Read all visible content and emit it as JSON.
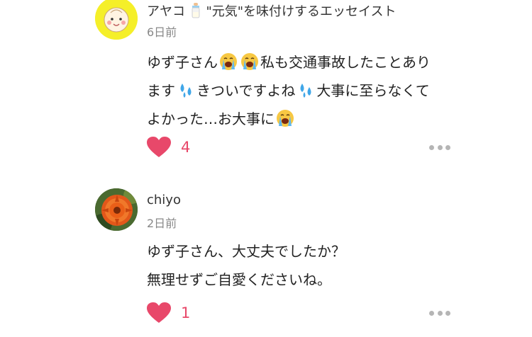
{
  "comments": [
    {
      "name_part1": "アヤコ",
      "name_part2": "\"元気\"を味付けするエッセイスト",
      "time": "6日前",
      "line1_a": "ゆず子さん",
      "line1_b": "私も交通事故したことあり",
      "line2_a": "ます",
      "line2_b": "きついですよね",
      "line2_c": "大事に至らなくて",
      "line3_a": "よかった…お大事に",
      "likes": "4",
      "avatar_icon": "smiling-baby-face-icon",
      "name_icon": "baby-bottle-icon"
    },
    {
      "name": "chiyo",
      "time": "2日前",
      "line1": "ゆず子さん、大丈夫でしたか？",
      "line2": "無理せずご自愛くださいね。",
      "likes": "1",
      "avatar_icon": "orange-flower-photo"
    }
  ],
  "icons": {
    "heart": "heart-icon",
    "more": "more-options-icon",
    "crying": "loudly-crying-face-emoji",
    "sweat": "sweat-droplets-emoji"
  },
  "colors": {
    "heart": "#e8486a",
    "like_count": "#e8486a",
    "time": "#888888",
    "more_dots": "#b5b5b5"
  }
}
